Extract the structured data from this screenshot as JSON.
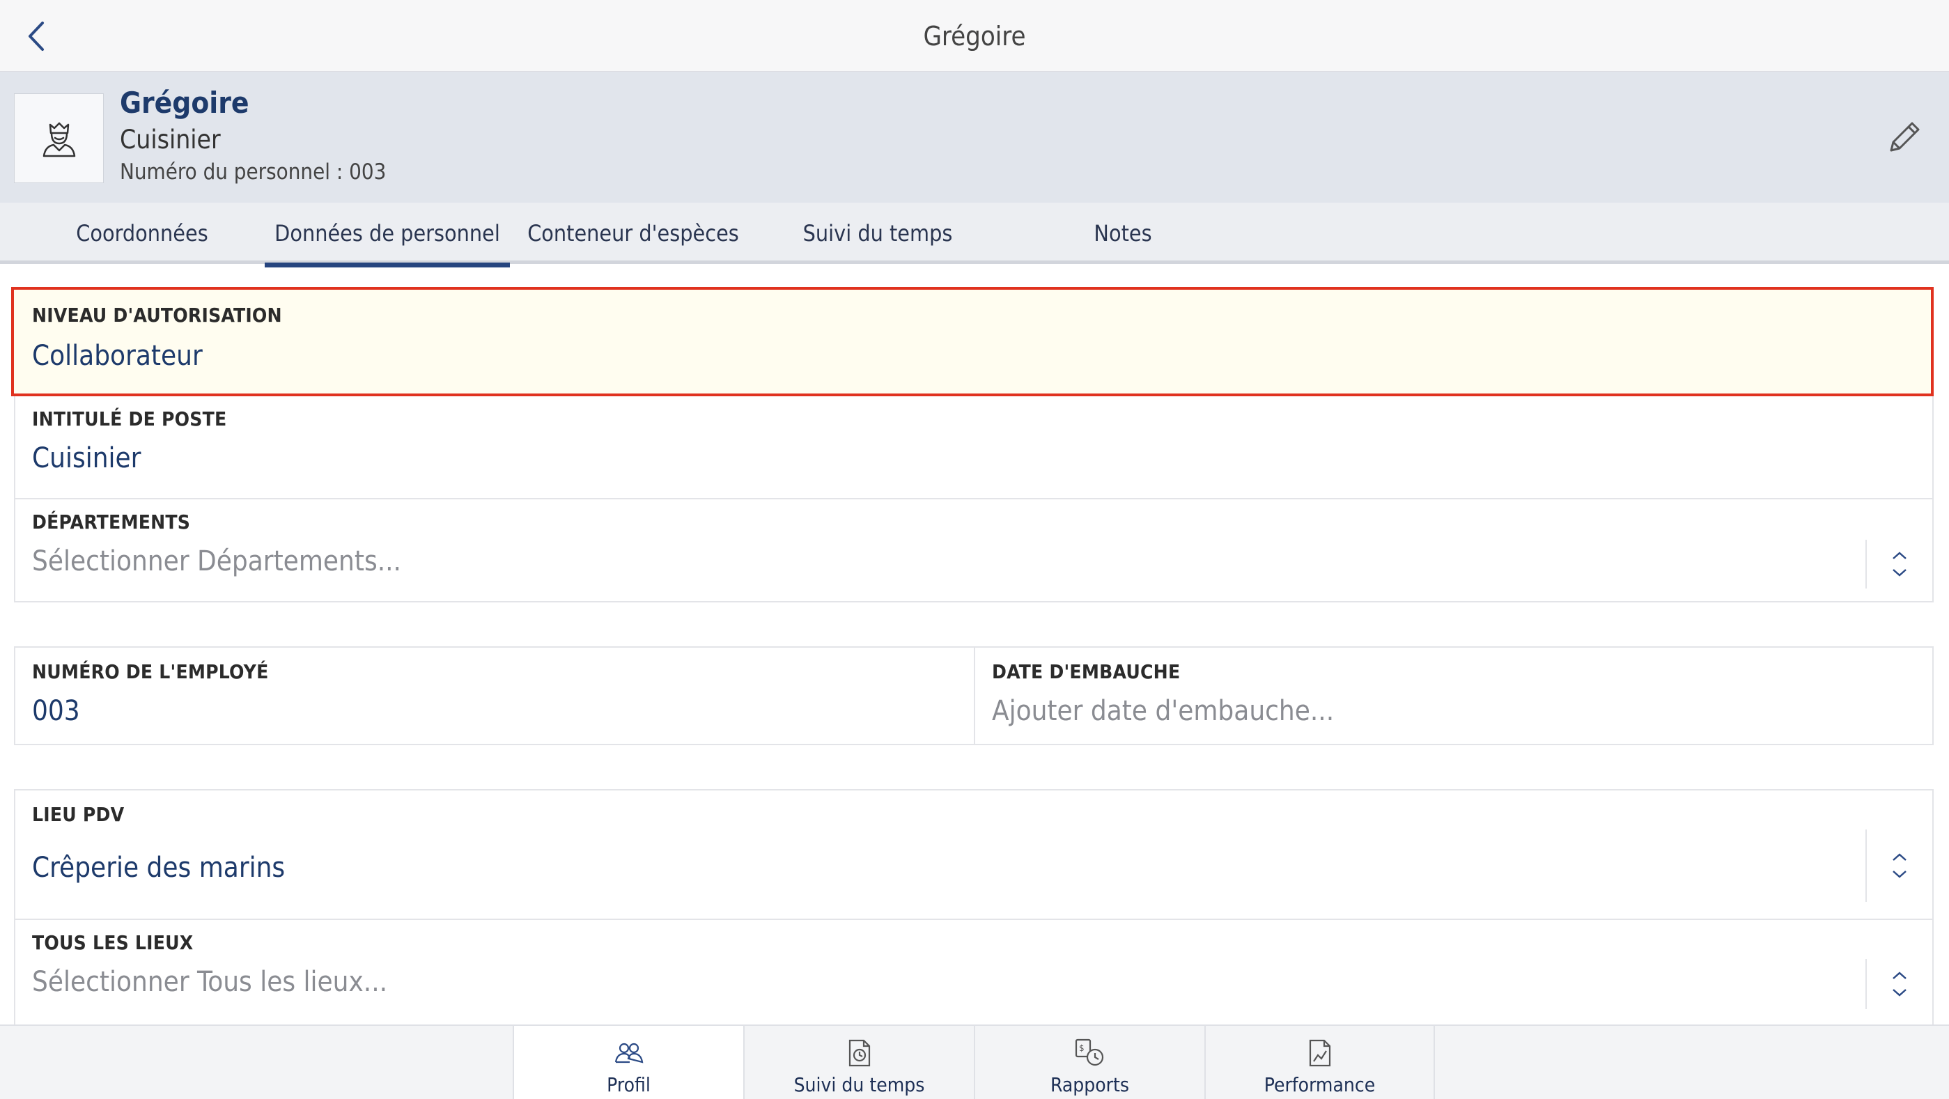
{
  "topbar": {
    "title": "Grégoire",
    "back_icon": "chevron-left-icon"
  },
  "profile": {
    "name": "Grégoire",
    "role": "Cuisinier",
    "personnel_number": "Numéro du personnel : 003",
    "avatar_icon": "chef-avatar-icon",
    "edit_icon": "pencil-icon"
  },
  "tabs": [
    {
      "label": "Coordonnées"
    },
    {
      "label": "Données de personnel",
      "active": true
    },
    {
      "label": "Conteneur d'espèces"
    },
    {
      "label": "Suivi du temps"
    },
    {
      "label": "Notes"
    }
  ],
  "fields": {
    "auth_level": {
      "label": "NIVEAU D'AUTORISATION",
      "value": "Collaborateur"
    },
    "job_title": {
      "label": "INTITULÉ DE POSTE",
      "value": "Cuisinier"
    },
    "departments": {
      "label": "DÉPARTEMENTS",
      "placeholder": "Sélectionner Départements..."
    },
    "employee_number": {
      "label": "NUMÉRO DE L'EMPLOYÉ",
      "value": "003"
    },
    "hire_date": {
      "label": "DATE D'EMBAUCHE",
      "placeholder": "Ajouter date d'embauche..."
    },
    "pos_location": {
      "label": "LIEU PDV",
      "value": "Crêperie des marins"
    },
    "all_locations": {
      "label": "TOUS LES LIEUX",
      "placeholder": "Sélectionner Tous les lieux..."
    }
  },
  "bottom_tabs": [
    {
      "label": "Profil",
      "icon": "people-icon",
      "active": true
    },
    {
      "label": "Suivi du temps",
      "icon": "clock-document-icon"
    },
    {
      "label": "Rapports",
      "icon": "reports-icon"
    },
    {
      "label": "Performance",
      "icon": "chart-document-icon"
    }
  ],
  "colors": {
    "accent": "#1d3a6b",
    "highlight_border": "#e0321f",
    "highlight_bg": "#fffdf0",
    "header_bg": "#e1e5ec"
  }
}
